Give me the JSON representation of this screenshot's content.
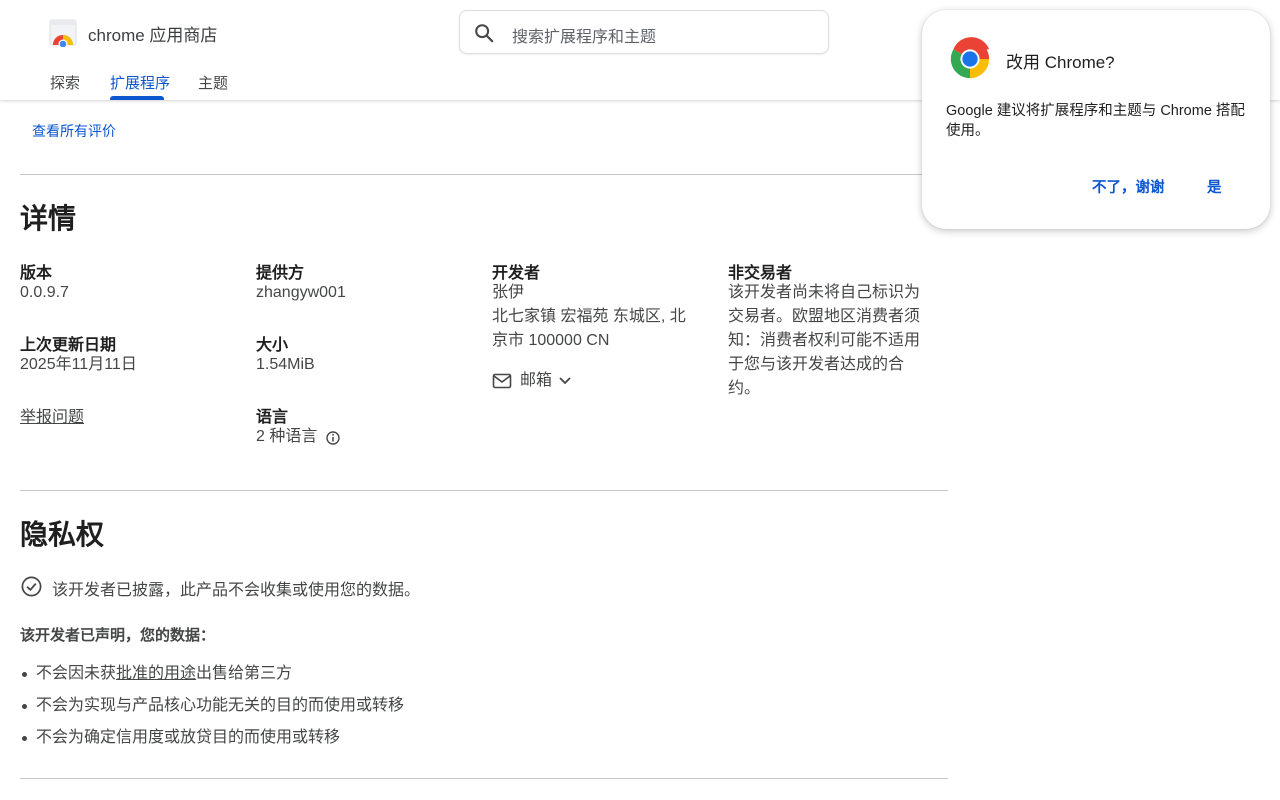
{
  "header": {
    "brand": "chrome 应用商店",
    "search_placeholder": "搜索扩展程序和主题",
    "tabs": [
      {
        "label": "探索",
        "active": false
      },
      {
        "label": "扩展程序",
        "active": true
      },
      {
        "label": "主题",
        "active": false
      }
    ]
  },
  "reviews": {
    "see_all_link": "查看所有评价"
  },
  "details": {
    "heading": "详情",
    "version": {
      "label": "版本",
      "value": "0.0.9.7"
    },
    "updated": {
      "label": "上次更新日期",
      "value": "2025年11月11日"
    },
    "report_link": "举报问题",
    "offered_by": {
      "label": "提供方",
      "value": "zhangyw001"
    },
    "size": {
      "label": "大小",
      "value": "1.54MiB"
    },
    "languages": {
      "label": "语言",
      "value": "2 种语言"
    },
    "developer": {
      "label": "开发者",
      "name": "张伊",
      "address": "北七家镇 宏福苑 东城区, 北京市 100000 CN",
      "email_label": "邮箱"
    },
    "trader": {
      "label": "非交易者",
      "value": "该开发者尚未将自己标识为交易者。欧盟地区消费者须知：消费者权利可能不适用于您与该开发者达成的合约。"
    }
  },
  "privacy": {
    "heading": "隐私权",
    "disclosure": "该开发者已披露，此产品不会收集或使用您的数据。",
    "declared": "该开发者已声明，您的数据：",
    "bullets": {
      "b1_pre": "不会因未获",
      "b1_link": "批准的用途",
      "b1_post": "出售给第三方",
      "b2": "不会为实现与产品核心功能无关的目的而使用或转移",
      "b3": "不会为确定信用度或放贷目的而使用或转移"
    }
  },
  "popup": {
    "title": "改用 Chrome?",
    "body": "Google 建议将扩展程序和主题与 Chrome 搭配使用。",
    "no_button": "不了，谢谢",
    "yes_button": "是"
  },
  "colors": {
    "accent": "#0b57d0",
    "text_primary": "#1f1f1f",
    "text_secondary": "#444746",
    "divider": "#c7c7c7"
  }
}
